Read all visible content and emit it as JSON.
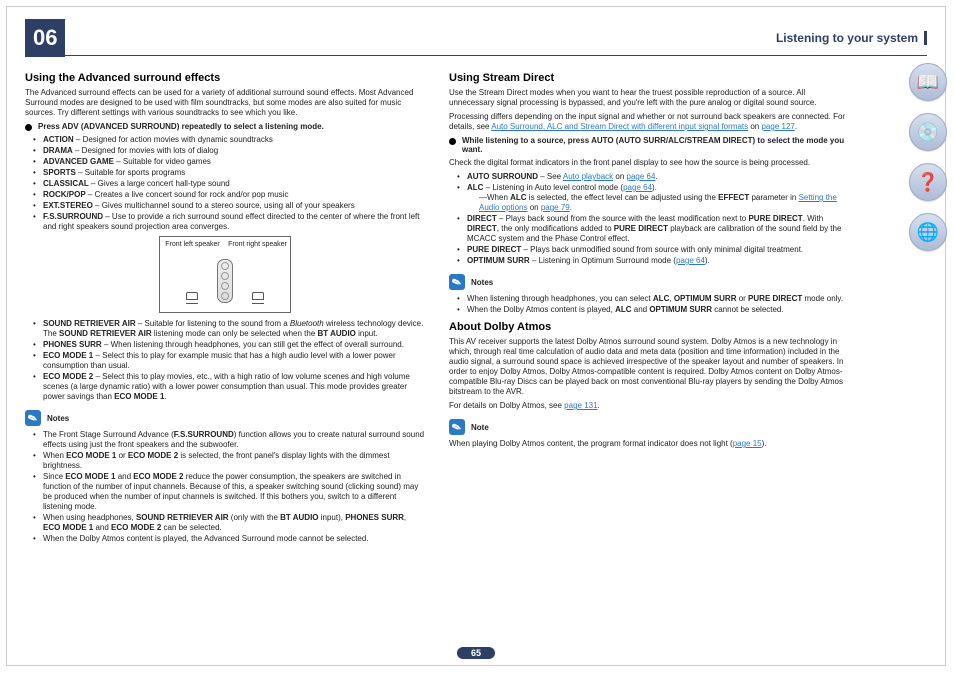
{
  "header": {
    "chapter": "06",
    "title": "Listening to your system"
  },
  "col1": {
    "h1": "Using the Advanced surround effects",
    "intro": "The Advanced surround effects can be used for a variety of additional surround sound effects. Most Advanced Surround modes are designed to be used with film soundtracks, but some modes are also suited for music sources. Try different settings with various soundtracks to see which you like.",
    "lead": "Press ADV (ADVANCED SURROUND) repeatedly to select a listening mode.",
    "modes": [
      {
        "t": "ACTION",
        "d": " – Designed for action movies with dynamic soundtracks"
      },
      {
        "t": "DRAMA",
        "d": " – Designed for movies with lots of dialog"
      },
      {
        "t": "ADVANCED GAME",
        "d": " – Suitable for video games"
      },
      {
        "t": "SPORTS",
        "d": " – Suitable for sports programs"
      },
      {
        "t": "CLASSICAL",
        "d": " – Gives a large concert hall-type sound"
      },
      {
        "t": "ROCK/POP",
        "d": " – Creates a live concert sound for rock and/or pop music"
      },
      {
        "t": "EXT.STEREO",
        "d": " – Gives multichannel sound to a stereo source, using all of your speakers"
      },
      {
        "t": "F.S.SURROUND",
        "d": " – Use to provide a rich surround sound effect directed to the center of where the front left and right speakers sound projection area converges."
      }
    ],
    "fig": {
      "left": "Front left speaker",
      "right": "Front right speaker"
    },
    "modes2a": {
      "t": "SOUND RETRIEVER AIR",
      "d1": " – Suitable for listening to the sound from a ",
      "it": "Bluetooth",
      "d2": " wireless technology device. The ",
      "t2": "SOUND RETRIEVER AIR",
      "d3": " listening mode can only be selected when the ",
      "t3": "BT AUDIO",
      "d4": " input."
    },
    "modes2": [
      {
        "t": "PHONES SURR",
        "d": " – When listening through headphones, you can still get the effect of overall surround."
      },
      {
        "t": "ECO MODE 1",
        "d": " – Select this to play for example music that has a high audio level with a lower power consumption than usual."
      }
    ],
    "modes2b": {
      "t": "ECO MODE 2",
      "d1": " – Select this to play movies, etc., with a high ratio of low volume scenes and high volume scenes (a large dynamic ratio) with a lower power consumption than usual. This mode provides greater power savings than ",
      "t2": "ECO MODE 1",
      "d2": "."
    },
    "notesLabel": "Notes",
    "note1": {
      "a": "The Front Stage Surround Advance (",
      "b": "F.S.SURROUND",
      "c": ") function allows you to create natural surround sound effects using just the front speakers and the subwoofer."
    },
    "note2": {
      "a": "When ",
      "b": "ECO MODE 1",
      "c": " or ",
      "d": "ECO MODE 2",
      "e": " is selected, the front panel's display lights with the dimmest brightness."
    },
    "note3": {
      "a": "Since ",
      "b": "ECO MODE 1",
      "c": " and ",
      "d": "ECO MODE 2",
      "e": " reduce the power consumption, the speakers are switched in function of the number of input channels. Because of this, a speaker switching sound (clicking sound) may be produced when the number of input channels is switched. If this bothers you, switch to a different listening mode."
    },
    "note4": {
      "a": "When using headphones, ",
      "b": "SOUND RETRIEVER AIR",
      "c": " (only with the ",
      "d": "BT AUDIO",
      "e": " input), ",
      "f": "PHONES SURR",
      "g": ", ",
      "h": "ECO MODE 1",
      "i": " and ",
      "j": "ECO MODE 2",
      "k": " can be selected."
    },
    "note5": "When the Dolby Atmos content is played, the Advanced Surround mode cannot be selected."
  },
  "col2": {
    "h1": "Using Stream Direct",
    "intro": "Use the Stream Direct modes when you want to hear the truest possible reproduction of a source. All unnecessary signal processing is bypassed, and you're left with the pure analog or digital sound source.",
    "intro2a": "Processing differs depending on the input signal and whether or not surround back speakers are connected. For details, see ",
    "intro2link": "Auto Surround, ALC and Stream Direct with different input signal formats",
    "intro2b": " on ",
    "intro2page": "page 127",
    "intro2c": ".",
    "lead": "While listening to a source, press AUTO (AUTO SURR/ALC/STREAM DIRECT) to select the mode you want.",
    "check": "Check the digital format indicators in the front panel display to see how the source is being processed.",
    "m1": {
      "t": "AUTO SURROUND",
      "d1": " – See ",
      "l": "Auto playback",
      "d2": " on ",
      "p": "page 64",
      "d3": "."
    },
    "m2": {
      "t": "ALC",
      "d1": " – Listening in Auto level control mode (",
      "p": "page 64",
      "d2": ")."
    },
    "m2b": {
      "a": "—When ",
      "b": "ALC",
      "c": " is selected, the effect level can be adjusted using the ",
      "d": "EFFECT",
      "e": " parameter in ",
      "l": "Setting the Audio options",
      "f": " on ",
      "p": "page 79",
      "g": "."
    },
    "m3": {
      "t": "DIRECT",
      "d1": " – Plays back sound from the source with the least modification next to ",
      "b": "PURE DIRECT",
      "d2": ". With ",
      "c": "DIRECT",
      "d3": ", the only modifications added to ",
      "d": "PURE DIRECT",
      "d4": " playback are calibration of the sound field by the MCACC system and the Phase Control effect."
    },
    "m4": {
      "t": "PURE DIRECT",
      "d": " – Plays back unmodified sound from source with only minimal digital treatment."
    },
    "m5": {
      "t": "OPTIMUM SURR",
      "d1": " – Listening in Optimum Surround mode (",
      "p": "page 64",
      "d2": ")."
    },
    "notesLabel": "Notes",
    "n1": {
      "a": "When listening through headphones, you can select ",
      "b": "ALC",
      "c": ", ",
      "d": "OPTIMUM SURR",
      "e": " or ",
      "f": "PURE DIRECT",
      "g": " mode only."
    },
    "n2": {
      "a": "When the Dolby Atmos content is played, ",
      "b": "ALC",
      "c": " and ",
      "d": "OPTIMUM SURR",
      "e": " cannot be selected."
    },
    "h2": "About Dolby Atmos",
    "atmos": "This AV receiver supports the latest Dolby Atmos surround sound system. Dolby Atmos is a new technology in which, through real time calculation of audio data and meta data (position and time information) included in the audio signal, a surround sound space is achieved irrespective of the speaker layout and number of speakers. In order to enjoy Dolby Atmos, Dolby Atmos-compatible content is required. Dolby Atmos content on Dolby Atmos-compatible Blu-ray Discs can be played back on most conventional Blu-ray players by sending the Dolby Atmos bitstream to the AVR.",
    "atmos2a": "For details on Dolby Atmos, see ",
    "atmos2p": "page 131",
    "atmos2b": ".",
    "noteLabel": "Note",
    "an1a": "When playing Dolby Atmos content, the program format indicator does not light (",
    "an1p": "page 15",
    "an1b": ")."
  },
  "pageNum": "65",
  "icons": {
    "book": "📖",
    "cd": "💿",
    "qmark": "❓",
    "globe": "🌐"
  }
}
